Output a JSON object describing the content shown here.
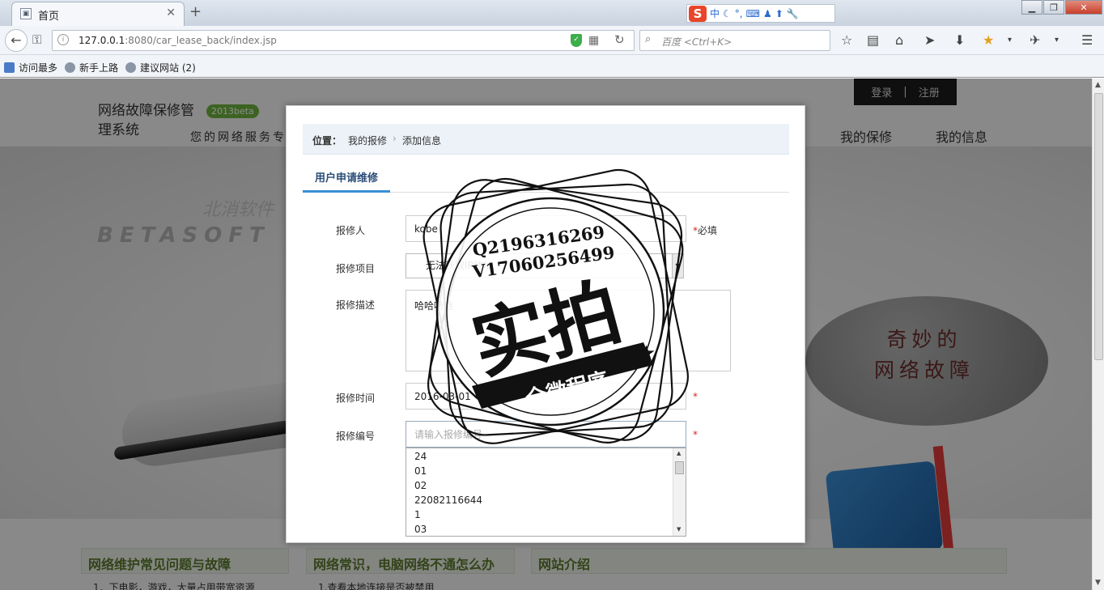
{
  "browser": {
    "tab_title": "首页",
    "tab_favicon": "image-icon",
    "url_host": "127.0.0.1",
    "url_rest": ":8080/car_lease_back/index.jsp",
    "search_placeholder": "百度 <Ctrl+K>",
    "ime_lang": "中",
    "bookmarks": [
      "访问最多",
      "新手上路",
      "建议网站 (2)"
    ]
  },
  "site": {
    "title": "网络故障保修管理系统",
    "badge": "2013beta",
    "slogan": "您的网络服务专",
    "auth_login": "登录",
    "auth_sep": "|",
    "auth_register": "注册",
    "nav": [
      "我的保修",
      "我的信息"
    ],
    "hero_logo_en": "BETASOFT",
    "hero_logo_cn": "北消软件",
    "bubble_text": "奇妙的\n网络故障",
    "sections": [
      {
        "title": "网络维护常见问题与故障",
        "first_item": "1．下电影，游戏，大量占用带宽资源"
      },
      {
        "title": "网络常识，电脑网络不通怎么办",
        "first_item": "1.查看本地连接是否被禁用"
      },
      {
        "title": "网站介绍",
        "first_item": ""
      }
    ]
  },
  "modal": {
    "breadcrumb_label": "位置：",
    "breadcrumb_items": [
      "我的报修",
      "添加信息"
    ],
    "tab": "用户申请维修",
    "form": {
      "reporter_label": "报修人",
      "reporter_value": "kobe",
      "reporter_required": "必填",
      "item_label": "报修项目",
      "item_value": "无法获取IP地址",
      "desc_label": "报修描述",
      "desc_value": "哈哈哈哈",
      "time_label": "报修时间",
      "time_value": "2016-03-01",
      "code_label": "报修编号",
      "code_placeholder": "请输入报修编号",
      "required_mark": "*"
    },
    "autocomplete": [
      "24",
      "01",
      "02",
      "22082116644",
      "1",
      "03"
    ]
  },
  "watermark": {
    "qq": "Q2196316269",
    "v": "V17060256499",
    "main": "实拍",
    "banner": "全微程序"
  }
}
